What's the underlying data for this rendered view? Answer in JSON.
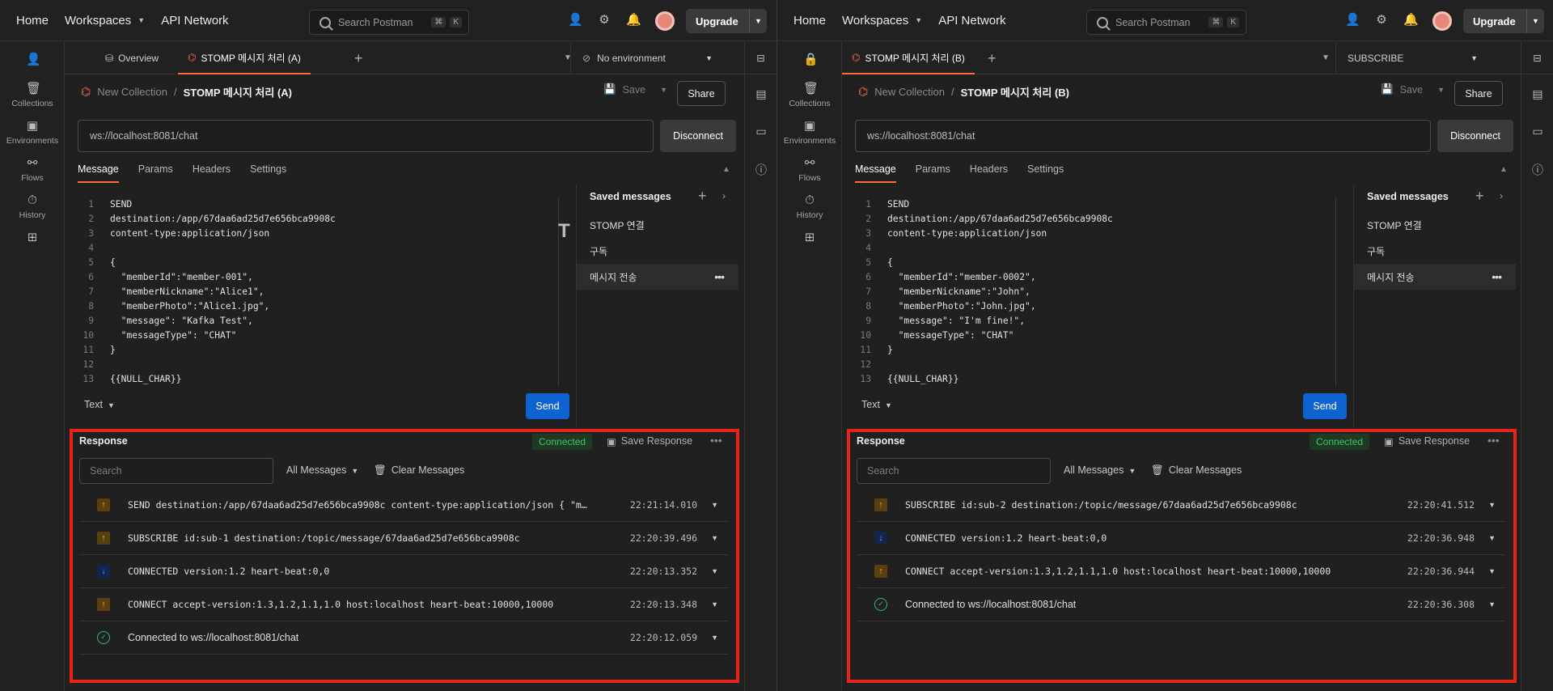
{
  "header": {
    "home": "Home",
    "workspaces": "Workspaces",
    "api_network": "API Network",
    "search_placeholder": "Search Postman",
    "kbd_cmd": "⌘",
    "kbd_k": "K",
    "upgrade": "Upgrade"
  },
  "sidebar": {
    "collections": "Collections",
    "environments": "Environments",
    "flows": "Flows",
    "history": "History"
  },
  "panes": [
    {
      "overview_tab": "Overview",
      "active_tab": "STOMP 메시지 처리 (A)",
      "environment": "No environment",
      "breadcrumb_collection": "New Collection",
      "breadcrumb_sep": "/",
      "request_name": "STOMP 메시지 처리 (A)",
      "save": "Save",
      "share": "Share",
      "url": "ws://localhost:8081/chat",
      "disconnect": "Disconnect",
      "msg_tabs": [
        "Message",
        "Params",
        "Headers",
        "Settings"
      ],
      "code_lines": [
        {
          "n": "1",
          "t": "SEND"
        },
        {
          "n": "2",
          "t": "destination:/app/67daa6ad25d7e656bca9908c"
        },
        {
          "n": "3",
          "t": "content-type:application/json"
        },
        {
          "n": "4",
          "t": ""
        },
        {
          "n": "5",
          "t": "{"
        },
        {
          "n": "6",
          "t": "  \"memberId\":\"member-001\","
        },
        {
          "n": "7",
          "t": "  \"memberNickname\":\"Alice1\","
        },
        {
          "n": "8",
          "t": "  \"memberPhoto\":\"Alice1.jpg\","
        },
        {
          "n": "9",
          "t": "  \"message\": \"Kafka Test\","
        },
        {
          "n": "10",
          "t": "  \"messageType\": \"CHAT\""
        },
        {
          "n": "11",
          "t": "}"
        },
        {
          "n": "12",
          "t": ""
        },
        {
          "n": "13",
          "t": "{{NULL_CHAR}}"
        }
      ],
      "text_format": "Text",
      "send": "Send",
      "saved_title": "Saved messages",
      "saved_items": [
        "STOMP 연결",
        "구독",
        "메시지 전송"
      ],
      "response_title": "Response",
      "status": "Connected",
      "save_response": "Save Response",
      "response_search": "Search",
      "all_messages": "All Messages",
      "clear_messages": "Clear Messages",
      "messages": [
        {
          "dir": "up",
          "text": "SEND destination:/app/67daa6ad25d7e656bca9908c content-type:application/json { \"m…",
          "time": "22:21:14.010"
        },
        {
          "dir": "up",
          "text": "SUBSCRIBE id:sub-1 destination:/topic/message/67daa6ad25d7e656bca9908c",
          "time": "22:20:39.496"
        },
        {
          "dir": "down",
          "text": "CONNECTED version:1.2 heart-beat:0,0",
          "time": "22:20:13.352"
        },
        {
          "dir": "up",
          "text": "CONNECT accept-version:1.3,1.2,1.1,1.0 host:localhost heart-beat:10000,10000",
          "time": "22:20:13.348"
        },
        {
          "dir": "ok",
          "text": "Connected to ws://localhost:8081/chat",
          "time": "22:20:12.059"
        }
      ]
    },
    {
      "overview_tab": "",
      "active_tab": "STOMP 메시지 처리 (B)",
      "environment": "SUBSCRIBE",
      "breadcrumb_collection": "New Collection",
      "breadcrumb_sep": "/",
      "request_name": "STOMP 메시지 처리 (B)",
      "save": "Save",
      "share": "Share",
      "url": "ws://localhost:8081/chat",
      "disconnect": "Disconnect",
      "msg_tabs": [
        "Message",
        "Params",
        "Headers",
        "Settings"
      ],
      "code_lines": [
        {
          "n": "1",
          "t": "SEND"
        },
        {
          "n": "2",
          "t": "destination:/app/67daa6ad25d7e656bca9908c"
        },
        {
          "n": "3",
          "t": "content-type:application/json"
        },
        {
          "n": "4",
          "t": ""
        },
        {
          "n": "5",
          "t": "{"
        },
        {
          "n": "6",
          "t": "  \"memberId\":\"member-0002\","
        },
        {
          "n": "7",
          "t": "  \"memberNickname\":\"John\","
        },
        {
          "n": "8",
          "t": "  \"memberPhoto\":\"John.jpg\","
        },
        {
          "n": "9",
          "t": "  \"message\": \"I'm fine!\","
        },
        {
          "n": "10",
          "t": "  \"messageType\": \"CHAT\""
        },
        {
          "n": "11",
          "t": "}"
        },
        {
          "n": "12",
          "t": ""
        },
        {
          "n": "13",
          "t": "{{NULL_CHAR}}"
        }
      ],
      "text_format": "Text",
      "send": "Send",
      "saved_title": "Saved messages",
      "saved_items": [
        "STOMP 연결",
        "구독",
        "메시지 전송"
      ],
      "response_title": "Response",
      "status": "Connected",
      "save_response": "Save Response",
      "response_search": "Search",
      "all_messages": "All Messages",
      "clear_messages": "Clear Messages",
      "messages": [
        {
          "dir": "up",
          "text": "SUBSCRIBE id:sub-2 destination:/topic/message/67daa6ad25d7e656bca9908c",
          "time": "22:20:41.512"
        },
        {
          "dir": "down",
          "text": "CONNECTED version:1.2 heart-beat:0,0",
          "time": "22:20:36.948"
        },
        {
          "dir": "up",
          "text": "CONNECT accept-version:1.3,1.2,1.1,1.0 host:localhost heart-beat:10000,10000",
          "time": "22:20:36.944"
        },
        {
          "dir": "ok",
          "text": "Connected to ws://localhost:8081/chat",
          "time": "22:20:36.308"
        }
      ]
    }
  ],
  "colors": {
    "accent": "#ff6c37",
    "send": "#0e63d1",
    "connected": "#3fc46a",
    "highlight_border": "#e8231a"
  }
}
